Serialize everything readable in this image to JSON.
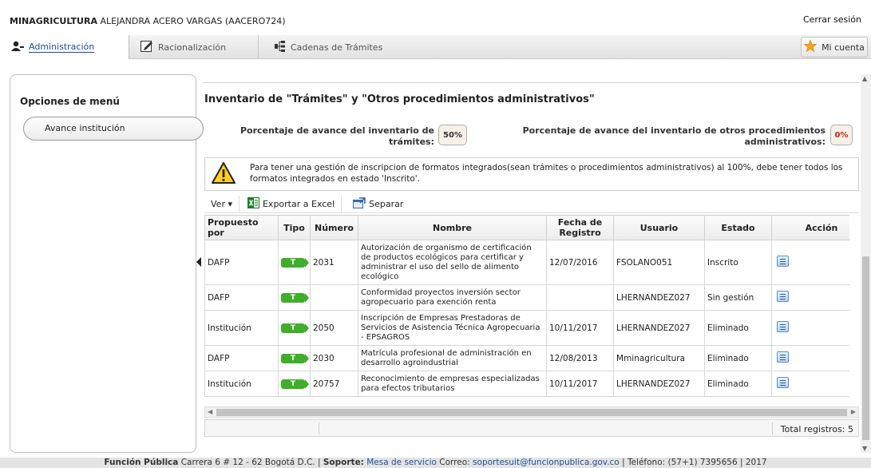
{
  "header": {
    "org": "MINAGRICULTURA",
    "user": "ALEJANDRA ACERO VARGAS (AACERO724)",
    "logout": "Cerrar sesión"
  },
  "tabs": [
    {
      "label": "Administración",
      "icon": "user-settings-icon"
    },
    {
      "label": "Racionalización",
      "icon": "edit-icon"
    },
    {
      "label": "Cadenas de Trámites",
      "icon": "chain-icon"
    }
  ],
  "account": {
    "label": "Mi cuenta",
    "icon": "star-icon"
  },
  "menu": {
    "title": "Opciones de menú",
    "items": [
      "Avance institución"
    ]
  },
  "main": {
    "title": "Inventario de \"Trámites\" y \"Otros procedimientos administrativos\"",
    "pct_tramites_label_1": "Porcentaje de avance del inventario de",
    "pct_tramites_label_2": "trámites:",
    "pct_tramites_value": "50%",
    "pct_otros_label_1": "Porcentaje de avance del inventario de otros procedimientos",
    "pct_otros_label_2": "administrativos:",
    "pct_otros_value": "0%",
    "warning": "Para tener una gestión de inscripcion de formatos integrados(sean trámites o procedimientos administrativos) al 100%, debe tener todos los formatos integrados en estado 'Inscrito'."
  },
  "toolbar": {
    "ver": "Ver ▾",
    "export": "Exportar a Excel",
    "separar": "Separar"
  },
  "table": {
    "columns": [
      "Propuesto por",
      "Tipo",
      "Número",
      "Nombre",
      "Fecha de Registro",
      "Usuario",
      "Estado",
      "Acción"
    ],
    "rows": [
      {
        "propuesto": "DAFP",
        "tipo": "T",
        "numero": "2031",
        "nombre": "Autorización de organismo de certificación de productos ecológicos para certificar y administrar el uso del sello de alimento ecológico",
        "fecha": "12/07/2016",
        "usuario": "FSOLANO051",
        "estado": "Inscrito"
      },
      {
        "propuesto": "DAFP",
        "tipo": "T",
        "numero": "",
        "nombre": "Conformidad proyectos inversión sector agropecuario para exención renta",
        "fecha": "",
        "usuario": "LHERNANDEZ027",
        "estado": "Sin gestión"
      },
      {
        "propuesto": "Institución",
        "tipo": "T",
        "numero": "2050",
        "nombre": "Inscripción de Empresas Prestadoras de Servicios de Asistencia Técnica Agropecuaria - EPSAGROS",
        "fecha": "10/11/2017",
        "usuario": "LHERNANDEZ027",
        "estado": "Eliminado"
      },
      {
        "propuesto": "DAFP",
        "tipo": "T",
        "numero": "2030",
        "nombre": "Matrícula profesional de administración en desarrollo agroindustrial",
        "fecha": "12/08/2013",
        "usuario": "Mminagricultura",
        "estado": "Eliminado"
      },
      {
        "propuesto": "Institución",
        "tipo": "T",
        "numero": "20757",
        "nombre": "Reconocimiento de empresas especializadas para efectos tributarios",
        "fecha": "10/11/2017",
        "usuario": "LHERNANDEZ027",
        "estado": "Eliminado"
      }
    ],
    "total": "Total registros: 5"
  },
  "footer": {
    "org": "Función Pública",
    "address": "Carrera 6 # 12 - 62 Bogotá D.C. |",
    "soporte_label": "Soporte:",
    "soporte_link": "Mesa de servicio",
    "correo_label": "Correo:",
    "correo": "soportesuit@funcionpublica.gov.co",
    "tel": "| Teléfono: (57+1) 7395656 | 2017"
  }
}
